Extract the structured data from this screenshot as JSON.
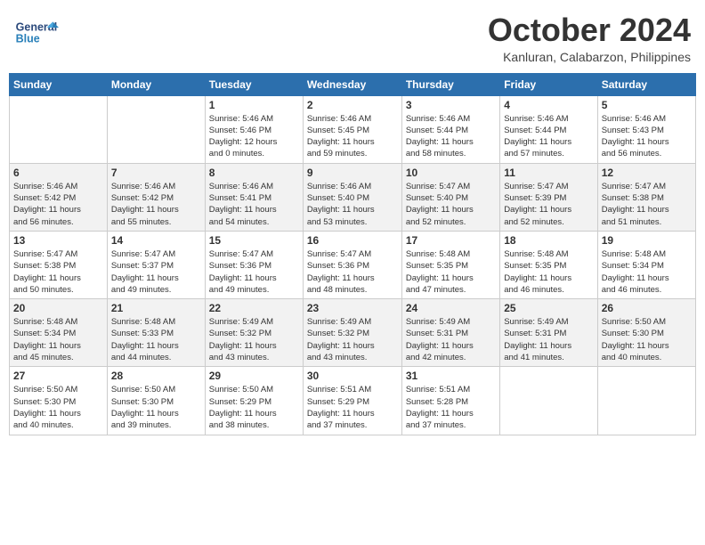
{
  "header": {
    "logo_line1": "General",
    "logo_line2": "Blue",
    "month": "October 2024",
    "location": "Kanluran, Calabarzon, Philippines"
  },
  "weekdays": [
    "Sunday",
    "Monday",
    "Tuesday",
    "Wednesday",
    "Thursday",
    "Friday",
    "Saturday"
  ],
  "weeks": [
    [
      {
        "day": "",
        "info": ""
      },
      {
        "day": "",
        "info": ""
      },
      {
        "day": "1",
        "info": "Sunrise: 5:46 AM\nSunset: 5:46 PM\nDaylight: 12 hours\nand 0 minutes."
      },
      {
        "day": "2",
        "info": "Sunrise: 5:46 AM\nSunset: 5:45 PM\nDaylight: 11 hours\nand 59 minutes."
      },
      {
        "day": "3",
        "info": "Sunrise: 5:46 AM\nSunset: 5:44 PM\nDaylight: 11 hours\nand 58 minutes."
      },
      {
        "day": "4",
        "info": "Sunrise: 5:46 AM\nSunset: 5:44 PM\nDaylight: 11 hours\nand 57 minutes."
      },
      {
        "day": "5",
        "info": "Sunrise: 5:46 AM\nSunset: 5:43 PM\nDaylight: 11 hours\nand 56 minutes."
      }
    ],
    [
      {
        "day": "6",
        "info": "Sunrise: 5:46 AM\nSunset: 5:42 PM\nDaylight: 11 hours\nand 56 minutes."
      },
      {
        "day": "7",
        "info": "Sunrise: 5:46 AM\nSunset: 5:42 PM\nDaylight: 11 hours\nand 55 minutes."
      },
      {
        "day": "8",
        "info": "Sunrise: 5:46 AM\nSunset: 5:41 PM\nDaylight: 11 hours\nand 54 minutes."
      },
      {
        "day": "9",
        "info": "Sunrise: 5:46 AM\nSunset: 5:40 PM\nDaylight: 11 hours\nand 53 minutes."
      },
      {
        "day": "10",
        "info": "Sunrise: 5:47 AM\nSunset: 5:40 PM\nDaylight: 11 hours\nand 52 minutes."
      },
      {
        "day": "11",
        "info": "Sunrise: 5:47 AM\nSunset: 5:39 PM\nDaylight: 11 hours\nand 52 minutes."
      },
      {
        "day": "12",
        "info": "Sunrise: 5:47 AM\nSunset: 5:38 PM\nDaylight: 11 hours\nand 51 minutes."
      }
    ],
    [
      {
        "day": "13",
        "info": "Sunrise: 5:47 AM\nSunset: 5:38 PM\nDaylight: 11 hours\nand 50 minutes."
      },
      {
        "day": "14",
        "info": "Sunrise: 5:47 AM\nSunset: 5:37 PM\nDaylight: 11 hours\nand 49 minutes."
      },
      {
        "day": "15",
        "info": "Sunrise: 5:47 AM\nSunset: 5:36 PM\nDaylight: 11 hours\nand 49 minutes."
      },
      {
        "day": "16",
        "info": "Sunrise: 5:47 AM\nSunset: 5:36 PM\nDaylight: 11 hours\nand 48 minutes."
      },
      {
        "day": "17",
        "info": "Sunrise: 5:48 AM\nSunset: 5:35 PM\nDaylight: 11 hours\nand 47 minutes."
      },
      {
        "day": "18",
        "info": "Sunrise: 5:48 AM\nSunset: 5:35 PM\nDaylight: 11 hours\nand 46 minutes."
      },
      {
        "day": "19",
        "info": "Sunrise: 5:48 AM\nSunset: 5:34 PM\nDaylight: 11 hours\nand 46 minutes."
      }
    ],
    [
      {
        "day": "20",
        "info": "Sunrise: 5:48 AM\nSunset: 5:34 PM\nDaylight: 11 hours\nand 45 minutes."
      },
      {
        "day": "21",
        "info": "Sunrise: 5:48 AM\nSunset: 5:33 PM\nDaylight: 11 hours\nand 44 minutes."
      },
      {
        "day": "22",
        "info": "Sunrise: 5:49 AM\nSunset: 5:32 PM\nDaylight: 11 hours\nand 43 minutes."
      },
      {
        "day": "23",
        "info": "Sunrise: 5:49 AM\nSunset: 5:32 PM\nDaylight: 11 hours\nand 43 minutes."
      },
      {
        "day": "24",
        "info": "Sunrise: 5:49 AM\nSunset: 5:31 PM\nDaylight: 11 hours\nand 42 minutes."
      },
      {
        "day": "25",
        "info": "Sunrise: 5:49 AM\nSunset: 5:31 PM\nDaylight: 11 hours\nand 41 minutes."
      },
      {
        "day": "26",
        "info": "Sunrise: 5:50 AM\nSunset: 5:30 PM\nDaylight: 11 hours\nand 40 minutes."
      }
    ],
    [
      {
        "day": "27",
        "info": "Sunrise: 5:50 AM\nSunset: 5:30 PM\nDaylight: 11 hours\nand 40 minutes."
      },
      {
        "day": "28",
        "info": "Sunrise: 5:50 AM\nSunset: 5:30 PM\nDaylight: 11 hours\nand 39 minutes."
      },
      {
        "day": "29",
        "info": "Sunrise: 5:50 AM\nSunset: 5:29 PM\nDaylight: 11 hours\nand 38 minutes."
      },
      {
        "day": "30",
        "info": "Sunrise: 5:51 AM\nSunset: 5:29 PM\nDaylight: 11 hours\nand 37 minutes."
      },
      {
        "day": "31",
        "info": "Sunrise: 5:51 AM\nSunset: 5:28 PM\nDaylight: 11 hours\nand 37 minutes."
      },
      {
        "day": "",
        "info": ""
      },
      {
        "day": "",
        "info": ""
      }
    ]
  ]
}
